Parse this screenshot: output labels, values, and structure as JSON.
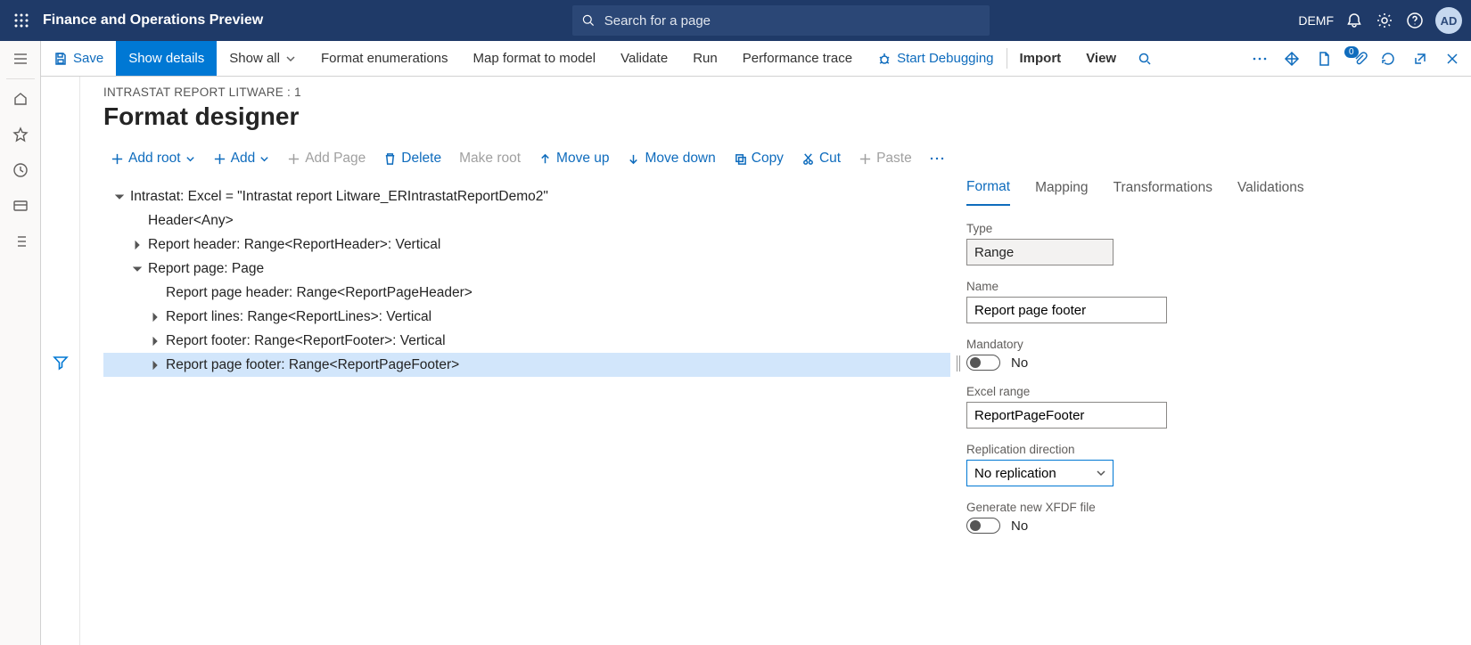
{
  "topbar": {
    "app_title": "Finance and Operations Preview",
    "search_placeholder": "Search for a page",
    "company": "DEMF",
    "avatar": "AD"
  },
  "cmdbar": {
    "save": "Save",
    "show_details": "Show details",
    "show_all": "Show all",
    "format_enum": "Format enumerations",
    "map_format": "Map format to model",
    "validate": "Validate",
    "run": "Run",
    "perf_trace": "Performance trace",
    "start_debug": "Start Debugging",
    "import": "Import",
    "view": "View",
    "badge": "0"
  },
  "page": {
    "breadcrumb": "INTRASTAT REPORT LITWARE : 1",
    "title": "Format designer"
  },
  "toolbar": {
    "add_root": "Add root",
    "add": "Add",
    "add_page": "Add Page",
    "delete": "Delete",
    "make_root": "Make root",
    "move_up": "Move up",
    "move_down": "Move down",
    "copy": "Copy",
    "cut": "Cut",
    "paste": "Paste"
  },
  "tree": [
    {
      "depth": 0,
      "expand": "open",
      "label": "Intrastat: Excel = \"Intrastat report Litware_ERIntrastatReportDemo2\""
    },
    {
      "depth": 1,
      "expand": "none",
      "label": "Header<Any>"
    },
    {
      "depth": 1,
      "expand": "closed",
      "label": "Report header: Range<ReportHeader>: Vertical"
    },
    {
      "depth": 1,
      "expand": "open",
      "label": "Report page: Page"
    },
    {
      "depth": 2,
      "expand": "none",
      "label": "Report page header: Range<ReportPageHeader>"
    },
    {
      "depth": 2,
      "expand": "closed",
      "label": "Report lines: Range<ReportLines>: Vertical"
    },
    {
      "depth": 2,
      "expand": "closed",
      "label": "Report footer: Range<ReportFooter>: Vertical"
    },
    {
      "depth": 2,
      "expand": "closed",
      "label": "Report page footer: Range<ReportPageFooter>",
      "selected": true
    }
  ],
  "tabs": {
    "format": "Format",
    "mapping": "Mapping",
    "transformations": "Transformations",
    "validations": "Validations"
  },
  "props": {
    "type_label": "Type",
    "type_value": "Range",
    "name_label": "Name",
    "name_value": "Report page footer",
    "mandatory_label": "Mandatory",
    "mandatory_value": "No",
    "excel_label": "Excel range",
    "excel_value": "ReportPageFooter",
    "replication_label": "Replication direction",
    "replication_value": "No replication",
    "xfdf_label": "Generate new XFDF file",
    "xfdf_value": "No"
  }
}
